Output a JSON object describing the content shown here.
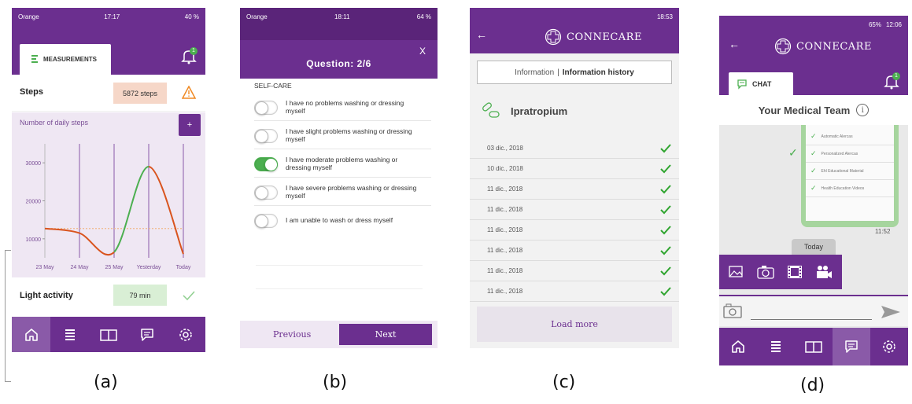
{
  "captions": [
    "(a)",
    "(b)",
    "(c)",
    "(d)"
  ],
  "colors": {
    "purple": "#6b2f8f",
    "light_purple": "#efe7f3",
    "green": "#4caf50",
    "check_green": "#2fa52f",
    "orange": "#d9541e",
    "alert_orange": "#f08a24"
  },
  "panel_a": {
    "status": {
      "carrier": "Orange",
      "time": "17:17",
      "battery": "40 %"
    },
    "notification_count": "1",
    "tab_label": "MEASUREMENTS",
    "steps": {
      "label": "Steps",
      "value": "5872 steps",
      "icon": "warning-icon"
    },
    "chart": {
      "title": "Number of daily steps",
      "add_label": "+",
      "y_ticks": [
        "30000",
        "20000",
        "10000"
      ],
      "x_ticks": [
        "23 May",
        "24 May",
        "25 May",
        "Yesterday",
        "Today"
      ]
    },
    "chart_data": {
      "type": "line",
      "categories": [
        "23 May",
        "24 May",
        "25 May",
        "Yesterday",
        "Today"
      ],
      "y_ticks": [
        10000,
        20000,
        30000
      ],
      "ylim": [
        5000,
        35000
      ],
      "series": [
        {
          "values": [
            12700,
            11500,
            6500,
            29000,
            6000
          ]
        },
        {
          "values": [
            12700,
            12700,
            12700,
            12700,
            12700
          ]
        }
      ],
      "grid": false
    },
    "light_activity": {
      "label": "Light activity",
      "value": "79 min",
      "icon": "check-icon"
    },
    "nav": [
      "home-icon",
      "list-icon",
      "book-icon",
      "chat-icon",
      "settings-icon"
    ]
  },
  "panel_b": {
    "status": {
      "carrier": "Orange",
      "time": "18:11",
      "battery": "64 %"
    },
    "close_label": "X",
    "question_title": "Question: 2/6",
    "section": "SELF-CARE",
    "options": [
      {
        "text": "I have no problems washing or dressing myself",
        "on": false
      },
      {
        "text": "I have slight problems washing or dressing myself",
        "on": false
      },
      {
        "text": "I have moderate problems washing or dressing myself",
        "on": true
      },
      {
        "text": "I have severe problems washing or dressing myself",
        "on": false
      },
      {
        "text": "I am unable to wash or dress myself",
        "on": false
      }
    ],
    "previous_label": "Previous",
    "next_label": "Next"
  },
  "panel_c": {
    "status": {
      "time": "18:53"
    },
    "logo": "CONNECARE",
    "tabs": {
      "information": "Information",
      "separator": "|",
      "history": "Information history"
    },
    "drug": "Ipratropium",
    "dates": [
      "03 dic., 2018",
      "10 dic., 2018",
      "11 dic., 2018",
      "11 dic., 2018",
      "11 dic., 2018",
      "11 dic., 2018",
      "11 dic., 2018",
      "11 dic., 2018"
    ],
    "load_more": "Load more"
  },
  "panel_d": {
    "status": {
      "battery": "65%",
      "time": "12:06"
    },
    "logo": "CONNECARE",
    "tab_label": "CHAT",
    "notification_count": "1",
    "team_title": "Your Medical Team",
    "menu_items": [
      "Automatic Alercas",
      "Personalized Alercas",
      "Ehl Educational Material",
      "Health Education Videos"
    ],
    "message_time": "11:52",
    "date_chip": "Today",
    "attach_icons": [
      "gallery-icon",
      "camera-icon",
      "film-icon",
      "video-camera-icon"
    ],
    "nav": [
      "home-icon",
      "list-icon",
      "book-icon",
      "chat-icon",
      "settings-icon"
    ]
  }
}
